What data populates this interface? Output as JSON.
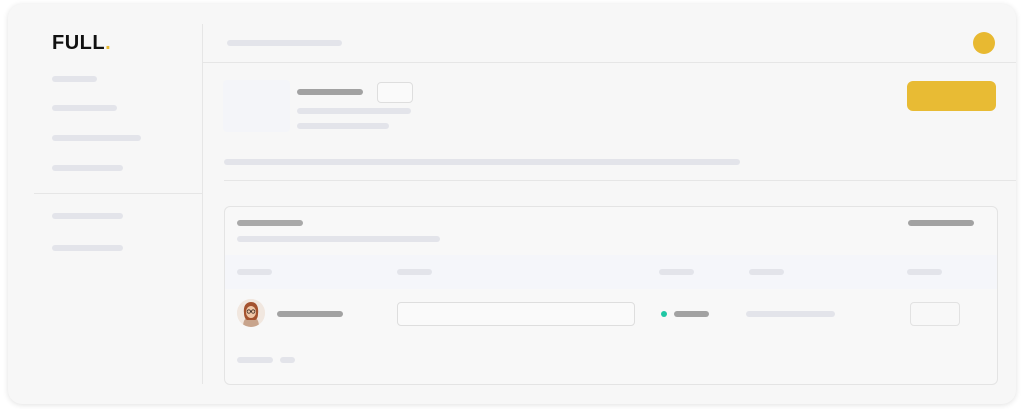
{
  "app": {
    "logo_text": "FULL",
    "logo_dot": ".",
    "accent_color": "#e8b931",
    "status_color": "#1fc7a4"
  },
  "icons": {
    "user_avatar": "user-avatar-icon",
    "person_photo": "person-photo-icon",
    "status": "status-dot-icon"
  }
}
